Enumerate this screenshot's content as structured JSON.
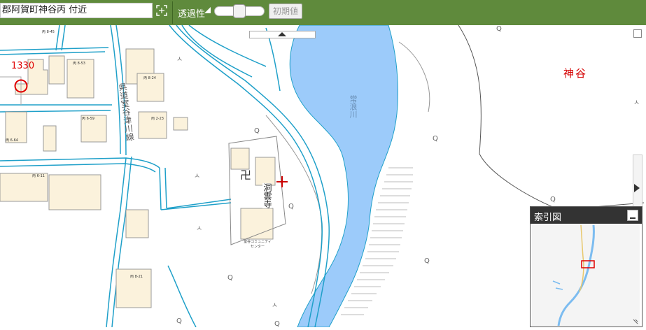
{
  "toolbar": {
    "address": "郡阿賀町神谷丙 付近",
    "transparency_label": "透過性",
    "reset_label": "初期値",
    "transparency_level": 0.5
  },
  "map": {
    "road_name": "県道室谷津川線",
    "river_name": "常浪川",
    "temple_name": "洞雲寺",
    "area_name": "神谷",
    "lot_number": "1330",
    "community_center": "室谷コミュニティセンター",
    "houses": [
      "丙 8-45",
      "丙 8-53",
      "丙 8-24",
      "丙 6-59",
      "丙 6-64",
      "丙 6-11",
      "丙 2-23",
      "丙 8-21"
    ]
  },
  "overview": {
    "title": "索引図"
  },
  "icons": {
    "fit": "fit-screen-icon",
    "crosshair": "crosshair-icon",
    "lot_marker": "circle-marker-icon",
    "minimize": "minimize-icon",
    "expand": "expand-arrow-icon"
  }
}
